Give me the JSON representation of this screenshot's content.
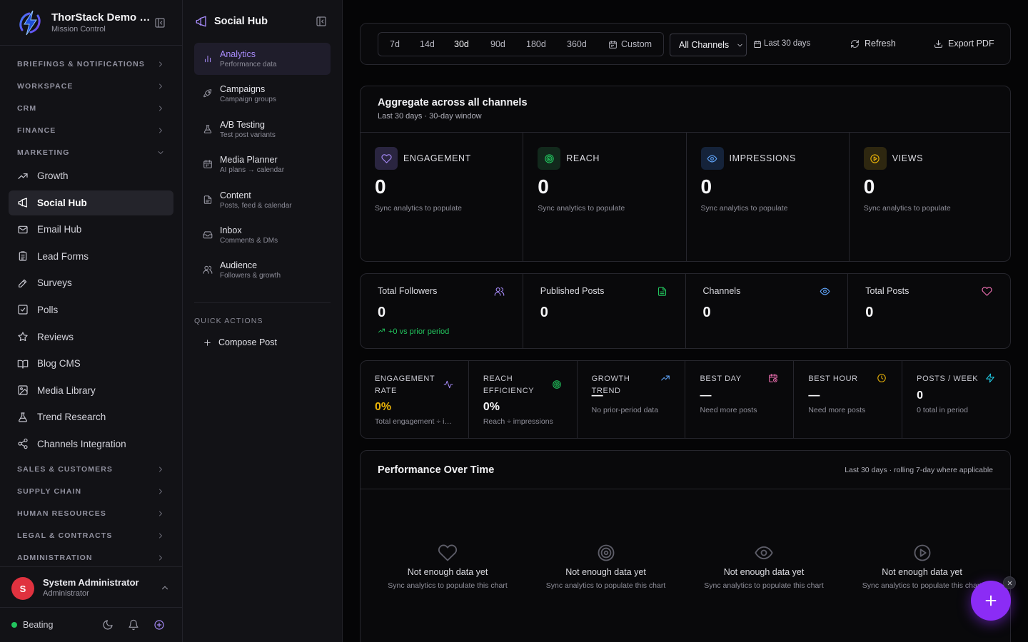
{
  "app": {
    "title": "ThorStack Demo Co.",
    "subtitle": "Mission Control"
  },
  "colors": {
    "accent": "#a78bfa",
    "success": "#22c55e",
    "fab": "#8b2cf5",
    "warning": "#eab308",
    "danger": "#e0323f"
  },
  "sidebar": {
    "sections_top": [
      {
        "label": "BRIEFINGS & NOTIFICATIONS",
        "expanded": false
      },
      {
        "label": "WORKSPACE",
        "expanded": false
      },
      {
        "label": "CRM",
        "expanded": false
      },
      {
        "label": "FINANCE",
        "expanded": false
      },
      {
        "label": "MARKETING",
        "expanded": true
      }
    ],
    "marketing_items": [
      {
        "label": "Growth",
        "icon": "trending-up-icon"
      },
      {
        "label": "Social Hub",
        "icon": "megaphone-icon",
        "active": true
      },
      {
        "label": "Email Hub",
        "icon": "mail-icon"
      },
      {
        "label": "Lead Forms",
        "icon": "clipboard-icon"
      },
      {
        "label": "Surveys",
        "icon": "pen-icon"
      },
      {
        "label": "Polls",
        "icon": "check-square-icon"
      },
      {
        "label": "Reviews",
        "icon": "star-icon"
      },
      {
        "label": "Blog CMS",
        "icon": "book-icon"
      },
      {
        "label": "Media Library",
        "icon": "image-icon"
      },
      {
        "label": "Trend Research",
        "icon": "flask-icon"
      },
      {
        "label": "Channels Integration",
        "icon": "share-icon"
      }
    ],
    "sections_bottom": [
      {
        "label": "SALES & CUSTOMERS"
      },
      {
        "label": "SUPPLY CHAIN"
      },
      {
        "label": "HUMAN RESOURCES"
      },
      {
        "label": "LEGAL & CONTRACTS"
      },
      {
        "label": "ADMINISTRATION"
      }
    ],
    "user": {
      "initial": "S",
      "name": "System Administrator",
      "role": "Administrator"
    },
    "status": {
      "label": "Beating"
    }
  },
  "subnav": {
    "title": "Social Hub",
    "items": [
      {
        "title": "Analytics",
        "subtitle": "Performance data",
        "icon": "bar-chart-icon",
        "active": true
      },
      {
        "title": "Campaigns",
        "subtitle": "Campaign groups",
        "icon": "rocket-icon"
      },
      {
        "title": "A/B Testing",
        "subtitle": "Test post variants",
        "icon": "flask-icon"
      },
      {
        "title": "Media Planner",
        "subtitle": "AI plans → calendar",
        "icon": "calendar-icon"
      },
      {
        "title": "Content",
        "subtitle": "Posts, feed & calendar",
        "icon": "file-icon"
      },
      {
        "title": "Inbox",
        "subtitle": "Comments & DMs",
        "icon": "inbox-icon"
      },
      {
        "title": "Audience",
        "subtitle": "Followers & growth",
        "icon": "users-icon"
      }
    ],
    "quick_actions_label": "QUICK ACTIONS",
    "quick_actions": [
      {
        "label": "Compose Post",
        "icon": "plus-icon"
      }
    ]
  },
  "toolbar": {
    "ranges": [
      "7d",
      "14d",
      "30d",
      "90d",
      "180d",
      "360d"
    ],
    "selected_range": "30d",
    "custom_label": "Custom",
    "channel_select": "All Channels",
    "range_label": "Last 30 days",
    "refresh_label": "Refresh",
    "export_label": "Export PDF"
  },
  "aggregate": {
    "title": "Aggregate across all channels",
    "subtitle": "Last 30 days · 30-day window",
    "metrics": [
      {
        "label": "ENGAGEMENT",
        "value": "0",
        "hint": "Sync analytics to populate",
        "icon": "heart-icon",
        "color": "#a78bfa",
        "bg": "#2a2540"
      },
      {
        "label": "REACH",
        "value": "0",
        "hint": "Sync analytics to populate",
        "icon": "target-icon",
        "color": "#22c55e",
        "bg": "#12291c"
      },
      {
        "label": "IMPRESSIONS",
        "value": "0",
        "hint": "Sync analytics to populate",
        "icon": "eye-icon",
        "color": "#60a5fa",
        "bg": "#15233a"
      },
      {
        "label": "VIEWS",
        "value": "0",
        "hint": "Sync analytics to populate",
        "icon": "play-icon",
        "color": "#eab308",
        "bg": "#2e2710"
      }
    ]
  },
  "totals": [
    {
      "label": "Total Followers",
      "value": "0",
      "delta": "+0 vs prior period",
      "icon": "users-icon",
      "color": "#a78bfa"
    },
    {
      "label": "Published Posts",
      "value": "0",
      "icon": "file-text-icon",
      "color": "#22c55e"
    },
    {
      "label": "Channels",
      "value": "0",
      "icon": "eye-icon",
      "color": "#60a5fa"
    },
    {
      "label": "Total Posts",
      "value": "0",
      "icon": "heart-icon",
      "color": "#f472b6"
    }
  ],
  "stats": [
    {
      "label": "ENGAGEMENT RATE",
      "value": "0%",
      "hint": "Total engagement ÷ impressions",
      "icon": "activity-icon",
      "color": "#a78bfa",
      "value_color": "#eab308",
      "two_line": true
    },
    {
      "label": "REACH EFFICIENCY",
      "value": "0%",
      "hint": "Reach ÷ impressions",
      "icon": "target-icon",
      "color": "#22c55e",
      "two_line": true
    },
    {
      "label": "GROWTH TREND",
      "value": "—",
      "hint": "No prior-period data",
      "icon": "trending-up-icon",
      "color": "#60a5fa",
      "two_line": false
    },
    {
      "label": "BEST DAY",
      "value": "—",
      "hint": "Need more posts",
      "icon": "calendar-clock-icon",
      "color": "#f472b6",
      "two_line": false
    },
    {
      "label": "BEST HOUR",
      "value": "—",
      "hint": "Need more posts",
      "icon": "clock-icon",
      "color": "#eab308",
      "two_line": false
    },
    {
      "label": "POSTS / WEEK",
      "value": "0",
      "hint": "0 total in period",
      "icon": "zap-icon",
      "color": "#22d3ee",
      "two_line": false
    }
  ],
  "performance": {
    "title": "Performance Over Time",
    "range": "Last 30 days · rolling 7-day where applicable",
    "empty_states": [
      {
        "title": "Not enough data yet",
        "subtitle": "Sync analytics to populate this chart",
        "icon": "heart-icon"
      },
      {
        "title": "Not enough data yet",
        "subtitle": "Sync analytics to populate this chart",
        "icon": "target-icon"
      },
      {
        "title": "Not enough data yet",
        "subtitle": "Sync analytics to populate this chart",
        "icon": "eye-icon"
      },
      {
        "title": "Not enough data yet",
        "subtitle": "Sync analytics to populate this chart",
        "icon": "play-icon"
      }
    ]
  }
}
